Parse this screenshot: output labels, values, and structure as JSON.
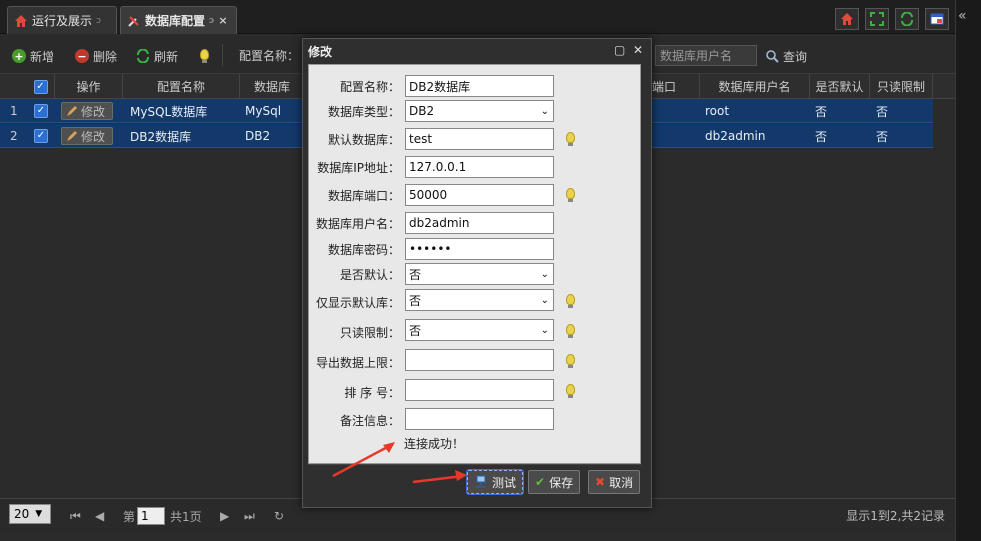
{
  "tabs": [
    {
      "label": "运行及展示",
      "icon": "home-icon"
    },
    {
      "label": "数据库配置",
      "icon": "tools-icon"
    }
  ],
  "tab_tools": [
    "home-icon",
    "fullscreen-icon",
    "refresh-icon",
    "window-icon"
  ],
  "toolbar": {
    "add_label": "新增",
    "delete_label": "删除",
    "refresh_label": "刷新",
    "config_name_label": "配置名称：",
    "db_user_placeholder": "数据库用户名",
    "query_label": "查询"
  },
  "grid": {
    "headers": [
      "操作",
      "配置名称",
      "数据库",
      "端口",
      "数据库用户名",
      "是否默认",
      "只读限制"
    ],
    "rows": [
      {
        "num": "1",
        "action": "修改",
        "name": "MySQL数据库",
        "type": "MySql",
        "user": "root",
        "is_default": "否",
        "readonly": "否"
      },
      {
        "num": "2",
        "action": "修改",
        "name": "DB2数据库",
        "type": "DB2",
        "user": "db2admin",
        "is_default": "否",
        "readonly": "否"
      }
    ]
  },
  "pager": {
    "page_size": "20",
    "page_prefix": "第",
    "page_value": "1",
    "page_total": "共1页",
    "summary": "显示1到2,共2记录"
  },
  "modal": {
    "title": "修改",
    "fields": [
      {
        "label": "配置名称：",
        "value": "DB2数据库",
        "kind": "text",
        "hint": false
      },
      {
        "label": "数据库类型：",
        "value": "DB2",
        "kind": "select",
        "hint": false
      },
      {
        "label": "默认数据库：",
        "value": "test",
        "kind": "text",
        "hint": true
      },
      {
        "label": "数据库IP地址：",
        "value": "127.0.0.1",
        "kind": "text",
        "hint": false
      },
      {
        "label": "数据库端口：",
        "value": "50000",
        "kind": "text",
        "hint": true
      },
      {
        "label": "数据库用户名：",
        "value": "db2admin",
        "kind": "text",
        "hint": false
      },
      {
        "label": "数据库密码：",
        "value": "••••••",
        "kind": "password",
        "hint": false
      },
      {
        "label": "是否默认：",
        "value": "否",
        "kind": "select",
        "hint": false
      },
      {
        "label": "仅显示默认库：",
        "value": "否",
        "kind": "select",
        "hint": true
      },
      {
        "label": "只读限制：",
        "value": "否",
        "kind": "select",
        "hint": true
      },
      {
        "label": "导出数据上限：",
        "value": "",
        "kind": "text",
        "hint": true
      },
      {
        "label": "排 序 号：",
        "value": "",
        "kind": "text",
        "hint": true
      },
      {
        "label": "备注信息：",
        "value": "",
        "kind": "text",
        "hint": false
      }
    ],
    "status": "连接成功！",
    "buttons": {
      "test": "测试",
      "save": "保存",
      "cancel": "取消"
    }
  },
  "colors": {
    "selected_row": "#13386a",
    "annotation_arrow": "#e53a2b",
    "bulb": "#e8d34a"
  }
}
